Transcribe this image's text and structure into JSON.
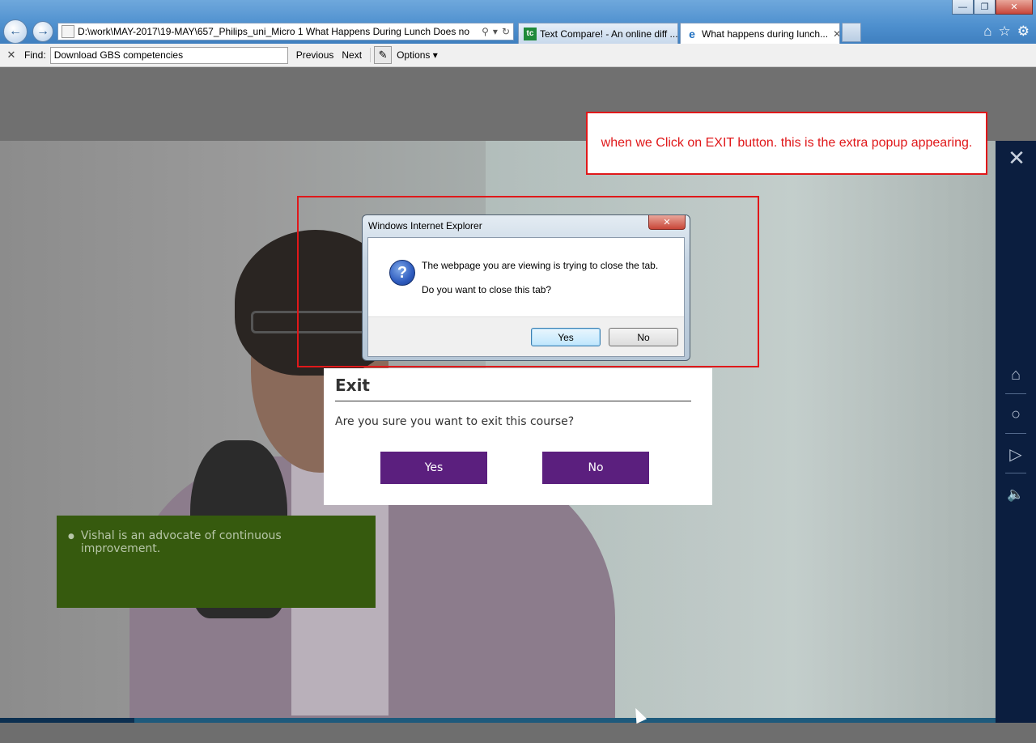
{
  "browser": {
    "address": "D:\\work\\MAY-2017\\19-MAY\\657_Philips_uni_Micro 1 What Happens During Lunch Does no",
    "tabs": [
      {
        "label": "Text Compare! - An online diff ...",
        "icon": "tc-icon",
        "icon_text": "tc"
      },
      {
        "label": "What happens during lunch...",
        "icon": "ie-icon"
      }
    ],
    "window_controls": [
      "minimize",
      "restore",
      "close"
    ]
  },
  "find_bar": {
    "label": "Find:",
    "value": "Download GBS competencies",
    "previous": "Previous",
    "next": "Next",
    "options": "Options"
  },
  "annotation": {
    "note": "when we Click on EXIT button. this is the extra popup appearing."
  },
  "ie_dialog": {
    "title": "Windows Internet Explorer",
    "message_line1": "The webpage you are viewing is trying to close the tab.",
    "message_line2": "Do you want to close this tab?",
    "yes": "Yes",
    "no": "No"
  },
  "exit_dialog": {
    "title": "Exit",
    "question": "Are you sure you want to exit this course?",
    "yes": "Yes",
    "no": "No"
  },
  "course": {
    "bullet": "Vishal is an advocate of continuous improvement.",
    "progress": 0.135
  },
  "right_nav": {
    "items": [
      "close-icon",
      "home-icon",
      "chat-icon",
      "play-icon",
      "volume-icon"
    ]
  },
  "colors": {
    "exit_button": "#5b1f7e",
    "info_box": "#365a0e",
    "annotation": "#e0181a",
    "right_nav": "#0b1e3f"
  }
}
